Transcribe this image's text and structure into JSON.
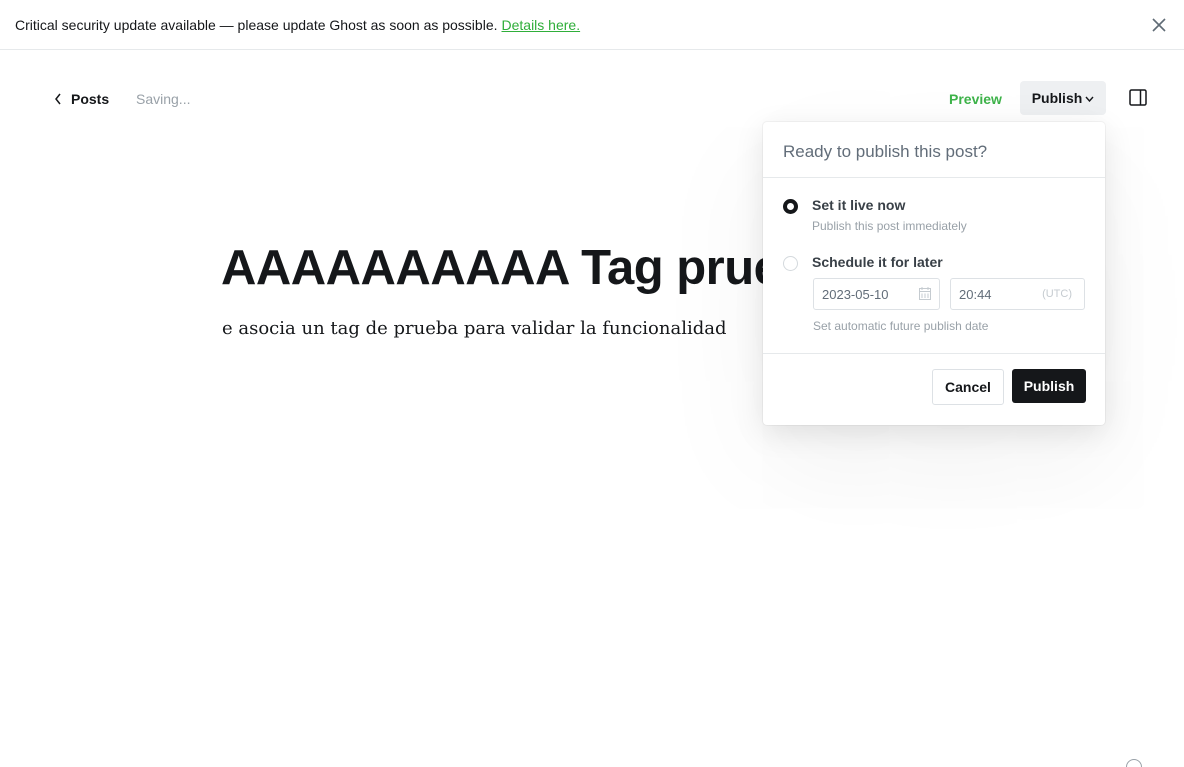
{
  "notice": {
    "message": "Critical security update available — please update Ghost as soon as possible.",
    "link_text": "Details here."
  },
  "header": {
    "back_label": "Posts",
    "status": "Saving...",
    "preview_label": "Preview",
    "publish_label": "Publish"
  },
  "post": {
    "title": "AAAAAAAAAA Tag prueba",
    "body": "e asocia un tag de prueba para validar la funcionalidad"
  },
  "publish_menu": {
    "heading": "Ready to publish this post?",
    "option_now": {
      "label": "Set it live now",
      "description": "Publish this post immediately",
      "selected": true
    },
    "option_schedule": {
      "label": "Schedule it for later",
      "selected": false,
      "date": "2023-05-10",
      "time": "20:44",
      "timezone": "(UTC)",
      "hint": "Set automatic future publish date"
    },
    "cancel_label": "Cancel",
    "publish_label": "Publish"
  },
  "colors": {
    "accent_green": "#3eb34a",
    "primary_dark": "#15171a"
  },
  "icons": {
    "close": "close-icon",
    "back": "chevron-left-icon",
    "dropdown": "chevron-down-icon",
    "sidebar": "sidebar-toggle-icon",
    "calendar": "calendar-icon"
  }
}
